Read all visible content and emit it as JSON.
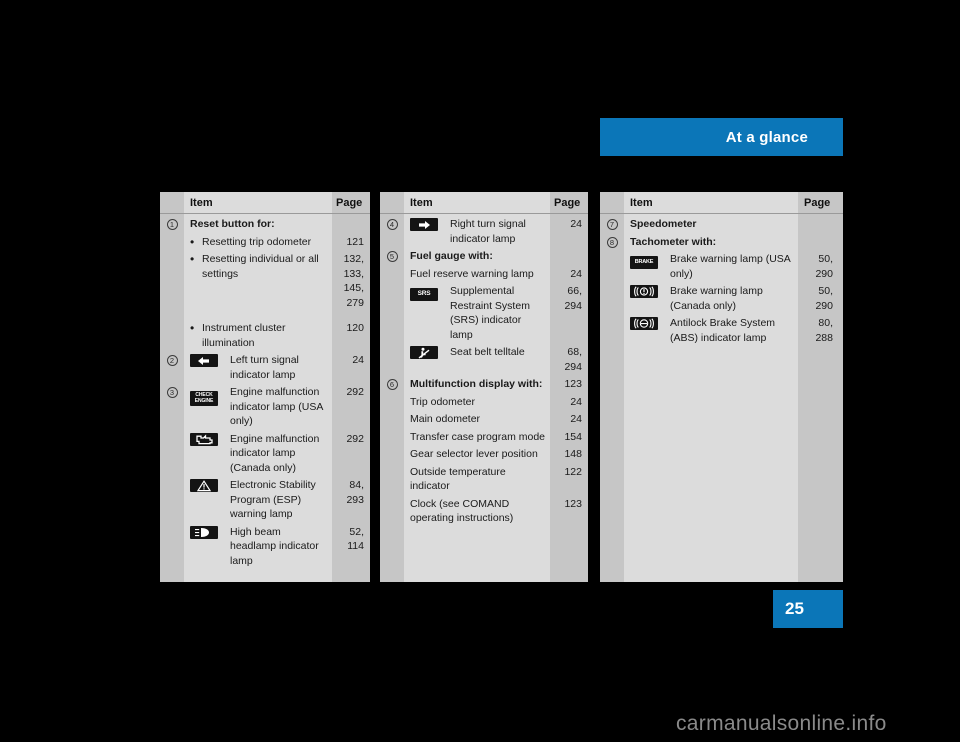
{
  "header": {
    "title": "At a glance"
  },
  "footer": {
    "page_number": "25",
    "watermark": "carmanualsonline.info"
  },
  "columns": [
    {
      "id": "col1",
      "header": {
        "item": "Item",
        "page": "Page"
      },
      "rows": [
        {
          "kind": "heading",
          "num": "1",
          "text": "Reset button for:",
          "page": ""
        },
        {
          "kind": "bullet",
          "num": "",
          "text": "Resetting trip odometer",
          "page": "121"
        },
        {
          "kind": "bullet",
          "num": "",
          "text": "Resetting individual or all settings",
          "page": "132,\n133,\n145,\n279"
        },
        {
          "kind": "spacer"
        },
        {
          "kind": "bullet",
          "num": "",
          "text": "Instrument cluster illumination",
          "page": "120"
        },
        {
          "kind": "icon",
          "num": "2",
          "icon": "left-turn-signal-icon",
          "text": "Left turn signal indicator lamp",
          "page": "24"
        },
        {
          "kind": "icon",
          "num": "3",
          "icon": "check-engine-icon",
          "text": "Engine malfunction indicator lamp (USA only)",
          "page": "292"
        },
        {
          "kind": "icon",
          "num": "",
          "icon": "engine-outline-icon",
          "text": "Engine malfunction indicator lamp (Canada only)",
          "page": "292"
        },
        {
          "kind": "icon",
          "num": "",
          "icon": "esp-triangle-icon",
          "text": "Electronic Stability Program (ESP) warning lamp",
          "page": "84,\n293"
        },
        {
          "kind": "icon",
          "num": "",
          "icon": "high-beam-icon",
          "text": "High beam headlamp indicator lamp",
          "page": "52,\n114"
        }
      ]
    },
    {
      "id": "col2",
      "header": {
        "item": "Item",
        "page": "Page"
      },
      "rows": [
        {
          "kind": "icon",
          "num": "4",
          "icon": "right-turn-signal-icon",
          "text": "Right turn signal indicator lamp",
          "page": "24"
        },
        {
          "kind": "heading",
          "num": "5",
          "text": "Fuel gauge with:",
          "page": ""
        },
        {
          "kind": "plain",
          "num": "",
          "text": "Fuel reserve warning lamp",
          "page": "24"
        },
        {
          "kind": "icon",
          "num": "",
          "icon": "srs-icon",
          "text": "Supplemental Restraint System (SRS) indicator lamp",
          "page": "66,\n294"
        },
        {
          "kind": "icon",
          "num": "",
          "icon": "seat-belt-icon",
          "text": "Seat belt telltale",
          "page": "68,\n294"
        },
        {
          "kind": "heading",
          "num": "6",
          "text": "Multifunction display with:",
          "page": "123"
        },
        {
          "kind": "plain",
          "num": "",
          "text": "Trip odometer",
          "page": "24"
        },
        {
          "kind": "plain",
          "num": "",
          "text": "Main odometer",
          "page": "24"
        },
        {
          "kind": "plain",
          "num": "",
          "text": "Transfer case program mode",
          "page": "154"
        },
        {
          "kind": "plain",
          "num": "",
          "text": "Gear selector lever position",
          "page": "148"
        },
        {
          "kind": "plain",
          "num": "",
          "text": "Outside temperature indicator",
          "page": "122"
        },
        {
          "kind": "plain",
          "num": "",
          "text": "Clock (see COMAND operating instructions)",
          "page": "123"
        }
      ]
    },
    {
      "id": "col3",
      "header": {
        "item": "Item",
        "page": "Page"
      },
      "rows": [
        {
          "kind": "heading",
          "num": "7",
          "text": "Speedometer",
          "page": ""
        },
        {
          "kind": "heading",
          "num": "8",
          "text": "Tachometer with:",
          "page": ""
        },
        {
          "kind": "icon",
          "num": "",
          "icon": "brake-warning-usa-icon",
          "text": "Brake warning lamp (USA only)",
          "page": "50,\n290"
        },
        {
          "kind": "icon",
          "num": "",
          "icon": "brake-warning-canada-icon",
          "text": "Brake warning lamp (Canada only)",
          "page": "50,\n290"
        },
        {
          "kind": "icon",
          "num": "",
          "icon": "abs-icon",
          "text": "Antilock Brake System (ABS) indicator lamp",
          "page": "80,\n288"
        }
      ]
    }
  ],
  "icon_labels": {
    "left-turn-signal-icon": "",
    "right-turn-signal-icon": "",
    "check-engine-icon_line1": "CHECK",
    "check-engine-icon_line2": "ENGINE",
    "srs-icon": "SRS",
    "brake-warning-usa-icon": "BRAKE"
  },
  "colors": {
    "accent": "#0b76b8",
    "table_body_bg": "#dcdcdc",
    "table_side_bg": "#c6c6c6",
    "page_bg": "#000000",
    "icon_bg": "#141414"
  }
}
